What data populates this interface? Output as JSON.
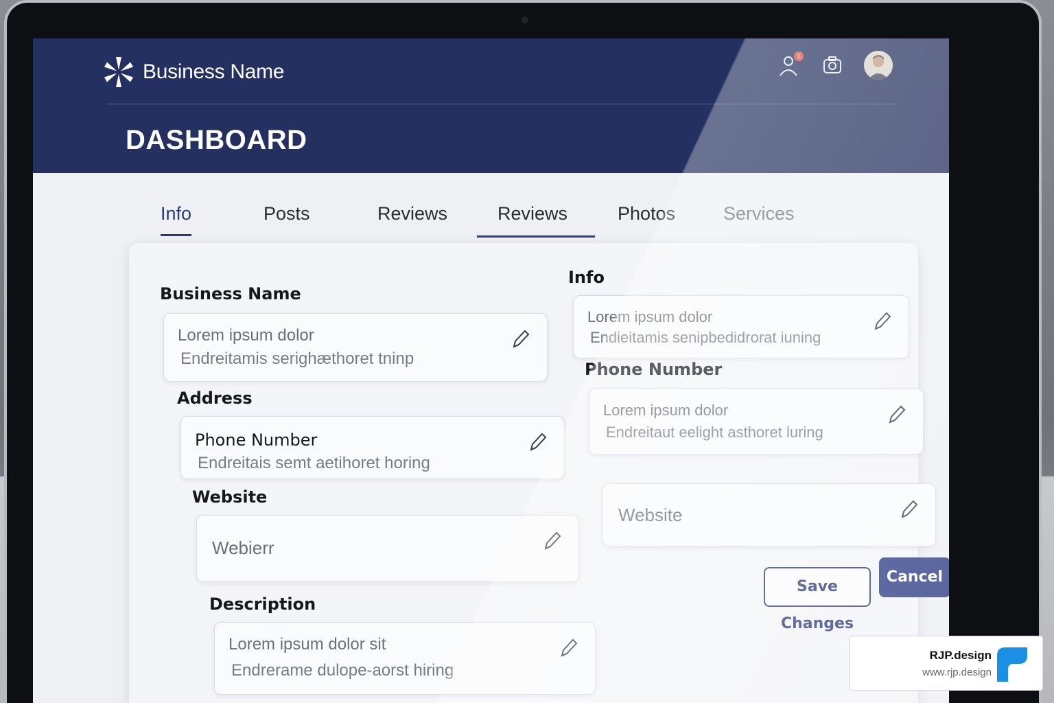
{
  "header": {
    "brand_name": "Business Name",
    "page_title": "DASHBOARD",
    "cart_badge": "1",
    "icons": [
      "logo-icon",
      "notification-person-icon",
      "camera-icon",
      "user-avatar"
    ],
    "bg_color": "#24305f"
  },
  "tabs": [
    {
      "label": "Info",
      "state": "active"
    },
    {
      "label": "Posts",
      "state": "normal"
    },
    {
      "label": "Reviews",
      "state": "normal"
    },
    {
      "label": "Reviews",
      "state": "selected"
    },
    {
      "label": "Photos",
      "state": "normal"
    },
    {
      "label": "Services",
      "state": "muted"
    }
  ],
  "form": {
    "left": {
      "business_name": {
        "label": "Business Name",
        "line1": "Lorem ipsum dolor",
        "line2": "Endreitamis serighæthoret tninp"
      },
      "address": {
        "label": "Address",
        "inner_label": "Phone Number",
        "line2": "Endreitais semt aetihoret horing"
      },
      "website": {
        "label": "Website",
        "value": "Webierr"
      },
      "description": {
        "label": "Description",
        "line1": "Lorem ipsum dolor sit",
        "line2": "Endrerame dulope-aorst hiring"
      }
    },
    "right": {
      "info": {
        "label": "Info",
        "line1": "Lorem ipsum dolor",
        "line2": "Endieitamis senipbedidrorat iuning"
      },
      "phone_number": {
        "label": "Phone Number",
        "line1": "Lorem ipsum dolor",
        "line2": "Endreitaut eelight asthoret luring"
      },
      "website": {
        "value": "Website"
      }
    }
  },
  "buttons": {
    "save_label": "Save Changes",
    "cancel_label": "Cancel",
    "accent_color": "#2f3d7e"
  },
  "watermark": {
    "name": "RJP.design",
    "url": "www.rjp.design",
    "logo_color": "#1a8fe3"
  }
}
